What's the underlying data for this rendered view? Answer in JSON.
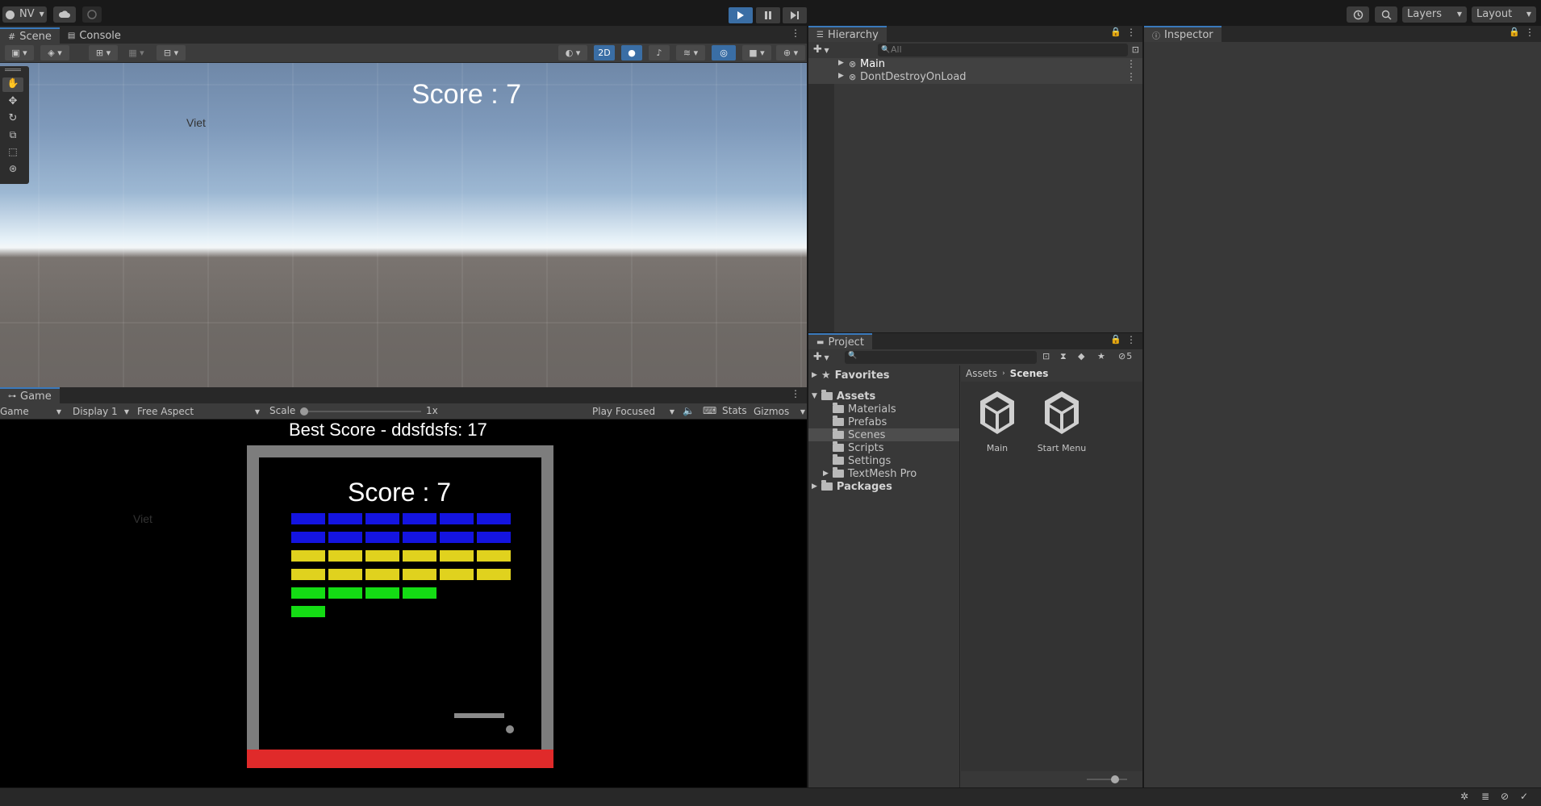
{
  "toolbar": {
    "account": "NV",
    "layers": "Layers",
    "layout": "Layout"
  },
  "scene_tabs": {
    "scene": "Scene",
    "console": "Console"
  },
  "scene_toolbar": {
    "mode_2d": "2D"
  },
  "scene_view": {
    "score_text": "Score : 7",
    "label_text": "Viet"
  },
  "game_panel": {
    "tab": "Game",
    "view_dropdown": "Game",
    "display": "Display 1",
    "aspect": "Free Aspect",
    "scale_label": "Scale",
    "scale_value": "1x",
    "play_focused": "Play Focused",
    "stats": "Stats",
    "gizmos": "Gizmos",
    "best_score": "Best Score -  ddsfdsfs: 17",
    "score": "Score : 7",
    "label_text": "Viet"
  },
  "colors": {
    "brick_blue": "#1414e0",
    "brick_yellow": "#e0d21e",
    "brick_green": "#14dc14",
    "floor_red": "#e02a2a",
    "wall_gray": "#7d7d7d",
    "accent": "#3a79bb"
  },
  "bricks": {
    "rows": [
      {
        "color": "blue",
        "count": 6
      },
      {
        "color": "blue",
        "count": 6
      },
      {
        "color": "yellow",
        "count": 6
      },
      {
        "color": "yellow",
        "count": 6
      },
      {
        "color": "green",
        "count": 4
      },
      {
        "color": "green",
        "count": 1
      }
    ]
  },
  "hierarchy": {
    "title": "Hierarchy",
    "search_placeholder": "All",
    "items": [
      "Main",
      "DontDestroyOnLoad"
    ]
  },
  "inspector": {
    "title": "Inspector"
  },
  "project": {
    "title": "Project",
    "hidden_count": "5",
    "favorites": "Favorites",
    "assets": "Assets",
    "folders": [
      "Materials",
      "Prefabs",
      "Scenes",
      "Scripts",
      "Settings",
      "TextMesh Pro"
    ],
    "packages": "Packages",
    "breadcrumb": [
      "Assets",
      "Scenes"
    ],
    "scene_assets": [
      "Main",
      "Start Menu"
    ]
  }
}
